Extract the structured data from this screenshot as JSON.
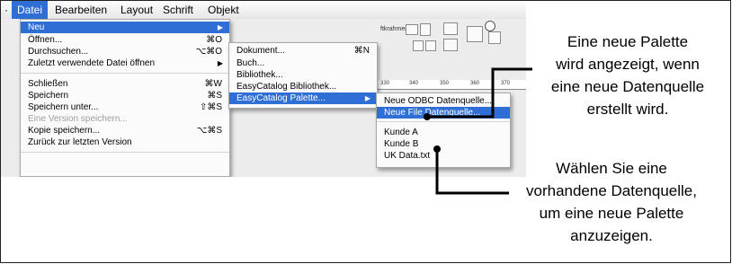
{
  "menubar": {
    "items": [
      "Datei",
      "Bearbeiten",
      "Layout",
      "Schrift",
      "Objekt"
    ]
  },
  "background": {
    "ruler_ticks": [
      "330",
      "340",
      "350",
      "360",
      "370"
    ],
    "fragment": "ftkrahmen"
  },
  "datei_menu": {
    "items": [
      {
        "label": "Neu",
        "shortcut": "",
        "submenu": true,
        "selected": true
      },
      {
        "label": "Öffnen...",
        "shortcut": "⌘O"
      },
      {
        "label": "Durchsuchen...",
        "shortcut": "⌥⌘O"
      },
      {
        "label": "Zuletzt verwendete Datei öffnen",
        "shortcut": "",
        "submenu": true
      },
      {
        "label": "Schließen",
        "shortcut": "⌘W"
      },
      {
        "label": "Speichern",
        "shortcut": "⌘S"
      },
      {
        "label": "Speichern unter...",
        "shortcut": "⇧⌘S"
      },
      {
        "label": "Eine Version speichern...",
        "shortcut": "",
        "disabled": true
      },
      {
        "label": "Kopie speichern...",
        "shortcut": "⌥⌘S"
      },
      {
        "label": "Zurück zur letzten Version",
        "shortcut": ""
      }
    ]
  },
  "neu_submenu": {
    "items": [
      {
        "label": "Dokument...",
        "shortcut": "⌘N"
      },
      {
        "label": "Buch...",
        "shortcut": ""
      },
      {
        "label": "Bibliothek...",
        "shortcut": ""
      },
      {
        "label": "EasyCatalog Bibliothek...",
        "shortcut": ""
      },
      {
        "label": "EasyCatalog Palette...",
        "shortcut": "",
        "submenu": true,
        "selected": true
      }
    ]
  },
  "palette_submenu": {
    "items": [
      {
        "label": "Neue ODBC Datenquelle...",
        "selected": false
      },
      {
        "label": "Neue File Datenquelle...",
        "selected": true
      },
      {
        "label": "Kunde A",
        "selected": false
      },
      {
        "label": "Kunde B",
        "selected": false
      },
      {
        "label": "UK Data.txt",
        "selected": false
      }
    ]
  },
  "callouts": {
    "top": [
      "Eine neue Palette",
      "wird angezeigt, wenn",
      "eine neue Datenquelle",
      "erstellt wird."
    ],
    "bottom": [
      "Wählen Sie eine",
      "vorhandene Datenquelle,",
      "um eine neue Palette",
      "anzuzeigen."
    ]
  },
  "colors": {
    "selection": "#2f6ed4",
    "menu_bg": "#fbfbfb",
    "disabled_text": "#9c9c9c"
  }
}
